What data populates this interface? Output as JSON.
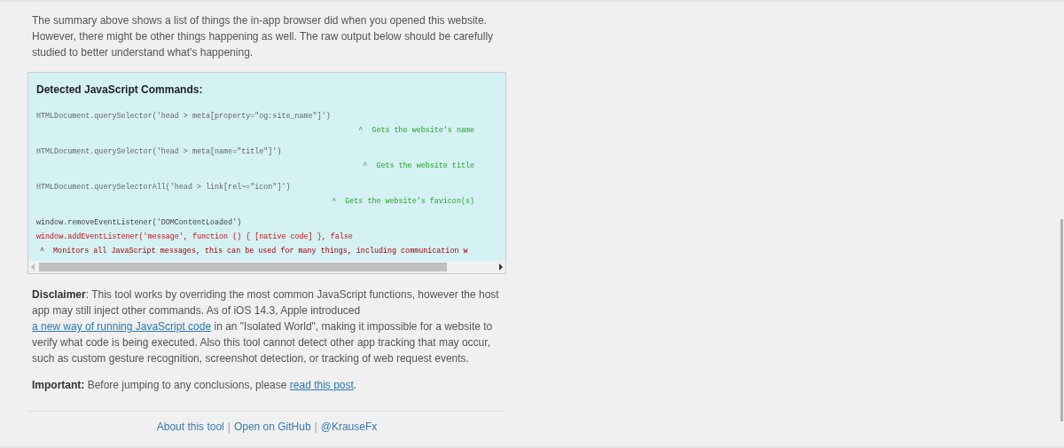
{
  "intro": "The summary above shows a list of things the in-app browser did when you opened this website. However, there might be other things happening as well. The raw output below should be carefully studied to better understand what's happening.",
  "commands": {
    "title": "Detected JavaScript Commands:",
    "lines": [
      {
        "kind": "call",
        "text": "HTMLDocument.querySelector('head > meta[property=\"og:site_name\"]')"
      },
      {
        "kind": "comment",
        "text": "^  Gets the website's name"
      },
      {
        "kind": "call",
        "text": "HTMLDocument.querySelector('head > meta[name=\"title\"]')"
      },
      {
        "kind": "comment",
        "text": "^  Gets the website title"
      },
      {
        "kind": "call",
        "text": "HTMLDocument.querySelectorAll('head > link[rel~=\"icon\"]')"
      },
      {
        "kind": "comment",
        "text": "^  Gets the website's favicon(s)"
      },
      {
        "kind": "plain",
        "text": "window.removeEventListener('DOMContentLoaded')"
      },
      {
        "kind": "alert_call",
        "text": "window.addEventListener('message', function () { [native code] }, false"
      },
      {
        "kind": "alert_comment",
        "text": "^  Monitors all JavaScript messages, this can be used for many things, including communication w"
      }
    ]
  },
  "disclaimer": {
    "label": "Disclaimer",
    "before": ": This tool works by overriding the most common JavaScript functions, however the host app may still inject other commands. As of iOS 14.3, Apple introduced ",
    "link": "a new way of running JavaScript code",
    "after": " in an \"Isolated World\", making it impossible for a website to verify what code is being executed. Also this tool cannot detect other app tracking that may occur, such as custom gesture recognition, screenshot detection, or tracking of web request events."
  },
  "important": {
    "label": "Important:",
    "before": " Before jumping to any conclusions, please ",
    "link": "read this post",
    "after": "."
  },
  "footer": {
    "links": [
      "About this tool",
      "Open on GitHub",
      "@KrauseFx"
    ],
    "separator": "|"
  }
}
